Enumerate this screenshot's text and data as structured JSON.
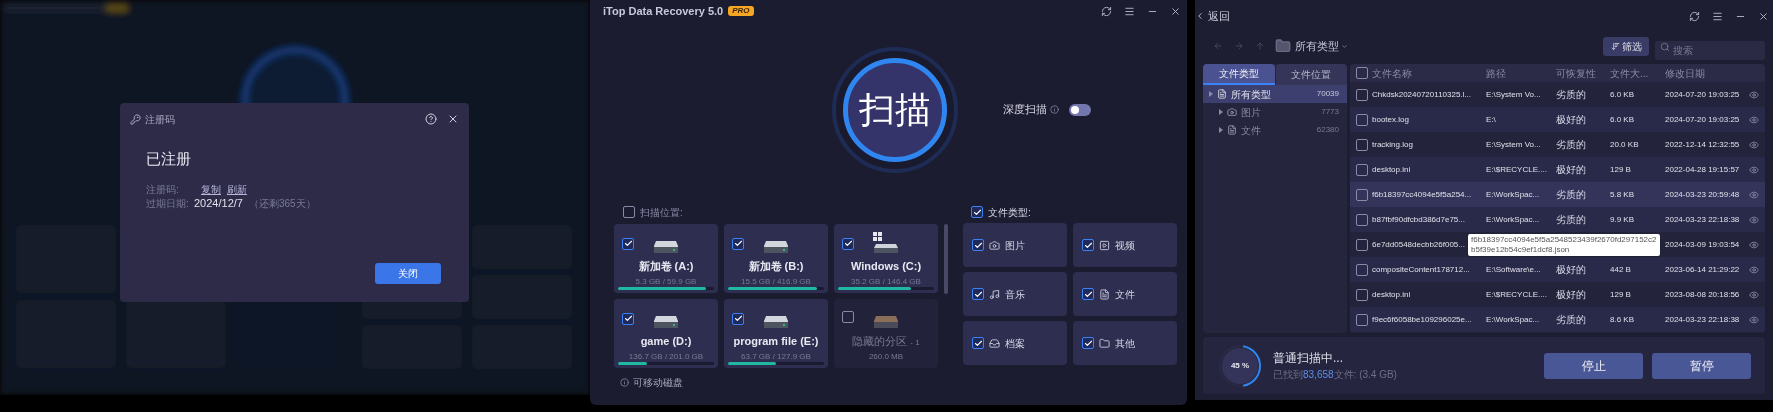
{
  "registration_dialog": {
    "title": "注册码",
    "status": "已注册",
    "code_label": "注册码:",
    "links": [
      "复制",
      "刷新"
    ],
    "expiry_label": "过期日期:",
    "expiry_date": "2024/12/7",
    "remaining": "（还剩365天）",
    "button": "关闭"
  },
  "scan_window": {
    "title": "iTop Data Recovery 5.0",
    "badge": "PRO",
    "scan_button": "扫描",
    "deep_scan": {
      "label": "深度扫描",
      "on": false
    },
    "location": {
      "label": "扫描位置:",
      "checked": false
    },
    "drives": [
      {
        "kind": "drive",
        "name": "新加卷 (A:)",
        "size": "5.3 GB / 59.9 GB",
        "level": 0.92,
        "checked": true
      },
      {
        "kind": "drive",
        "name": "新加卷 (B:)",
        "size": "15.5 GB / 416.9 GB",
        "level": 0.93,
        "checked": true
      },
      {
        "kind": "windows",
        "name": "Windows (C:)",
        "size": "35.2 GB / 146.4 GB",
        "level": 0.76,
        "checked": true
      },
      {
        "kind": "drive",
        "name": "game (D:)",
        "size": "136.7 GB / 201.0 GB",
        "level": 0.3,
        "checked": true
      },
      {
        "kind": "drive",
        "name": "program file (E:)",
        "size": "63.7 GB / 127.9 GB",
        "level": 0.5,
        "checked": true
      },
      {
        "kind": "hidden",
        "name": "隐藏的分区",
        "suffix": "- 1",
        "size": "260.0 MB",
        "checked": false
      }
    ],
    "removable": "可移动磁盘",
    "file_types": {
      "label": "文件类型:",
      "checked": true,
      "items": [
        {
          "kind": "image",
          "label": "图片",
          "checked": true
        },
        {
          "kind": "video",
          "label": "视频",
          "checked": true
        },
        {
          "kind": "music",
          "label": "音乐",
          "checked": true
        },
        {
          "kind": "document",
          "label": "文件",
          "checked": true
        },
        {
          "kind": "archive",
          "label": "档案",
          "checked": true
        },
        {
          "kind": "other",
          "label": "其他",
          "checked": true
        }
      ]
    }
  },
  "results_window": {
    "back": "返回",
    "folder": "所有类型",
    "filter": "筛选",
    "search": {
      "placeholder": "搜索"
    },
    "tabs": [
      {
        "label": "文件类型",
        "selected": true
      },
      {
        "label": "文件位置",
        "selected": false
      }
    ],
    "tree": [
      {
        "kind": "all",
        "label": "所有类型",
        "count": "70039",
        "selected": true,
        "children": [
          {
            "kind": "image",
            "label": "图片",
            "count": "7773",
            "selected": false
          },
          {
            "kind": "document",
            "label": "文件",
            "count": "62380",
            "selected": false
          }
        ]
      }
    ],
    "table": {
      "all_checked": false,
      "columns": [
        "文件名称",
        "路径",
        "可恢复性",
        "文件大...",
        "修改日期"
      ],
      "rows": [
        {
          "name": "Chkdsk20240720110325.l...",
          "path": "E:\\System Vo...",
          "quality": "劣质的",
          "size": "6.0 KB",
          "date": "2024-07-20 19:03:25",
          "checked": false,
          "hovered": false
        },
        {
          "name": "bootex.log",
          "path": "E:\\",
          "quality": "极好的",
          "size": "6.0 KB",
          "date": "2024-07-20 19:03:25",
          "checked": false,
          "hovered": false
        },
        {
          "name": "tracking.log",
          "path": "E:\\System Vo...",
          "quality": "劣质的",
          "size": "20.0 KB",
          "date": "2022-12-14 12:32:55",
          "checked": false,
          "hovered": false
        },
        {
          "name": "desktop.ini",
          "path": "E:\\$RECYCLE....",
          "quality": "极好的",
          "size": "129 B",
          "date": "2022-04-28 19:15:57",
          "checked": false,
          "hovered": false
        },
        {
          "name": "f6b18397cc4094e5f5a254...",
          "path": "E:\\WorkSpac...",
          "quality": "劣质的",
          "size": "5.8 KB",
          "date": "2024-03-23 20:59:48",
          "checked": false,
          "hovered": true
        },
        {
          "name": "b87fbf90dfcbd386d7e75...",
          "path": "E:\\WorkSpac...",
          "quality": "劣质的",
          "size": "9.9 KB",
          "date": "2024-03-23 22:18:38",
          "checked": false,
          "hovered": false
        },
        {
          "name": "6e7dd0548decbb26f005...",
          "date": "2024-03-09 19:03:54",
          "checked": false,
          "hovered": false
        },
        {
          "name": "compositeContent178712...",
          "path": "E:\\Software\\e...",
          "quality": "极好的",
          "size": "442 B",
          "date": "2023-06-14 21:29:22",
          "checked": false,
          "hovered": false
        },
        {
          "name": "desktop.ini",
          "path": "E:\\$RECYCLE....",
          "quality": "极好的",
          "size": "129 B",
          "date": "2023-08-08 20:18:56",
          "checked": false,
          "hovered": false
        },
        {
          "name": "f9ec6f6058be109296025e...",
          "path": "E:\\WorkSpac...",
          "quality": "劣质的",
          "size": "8.6 KB",
          "date": "2024-03-23 22:18:38",
          "checked": false,
          "hovered": false
        }
      ]
    },
    "tooltip": {
      "lines": [
        "f6b18397cc4094e5f5a2548523439f2670fd297152c2",
        "b5f39e12b54c9ef1dcf8.json"
      ]
    },
    "progress": {
      "level": 0.45,
      "reading": "45 %",
      "status": "普通扫描中...",
      "found_prefix": "已找到",
      "found_count": "83,658",
      "found_suffix": "文件: (3.4 GB)"
    },
    "buttons": [
      "停止",
      "暂停"
    ]
  }
}
